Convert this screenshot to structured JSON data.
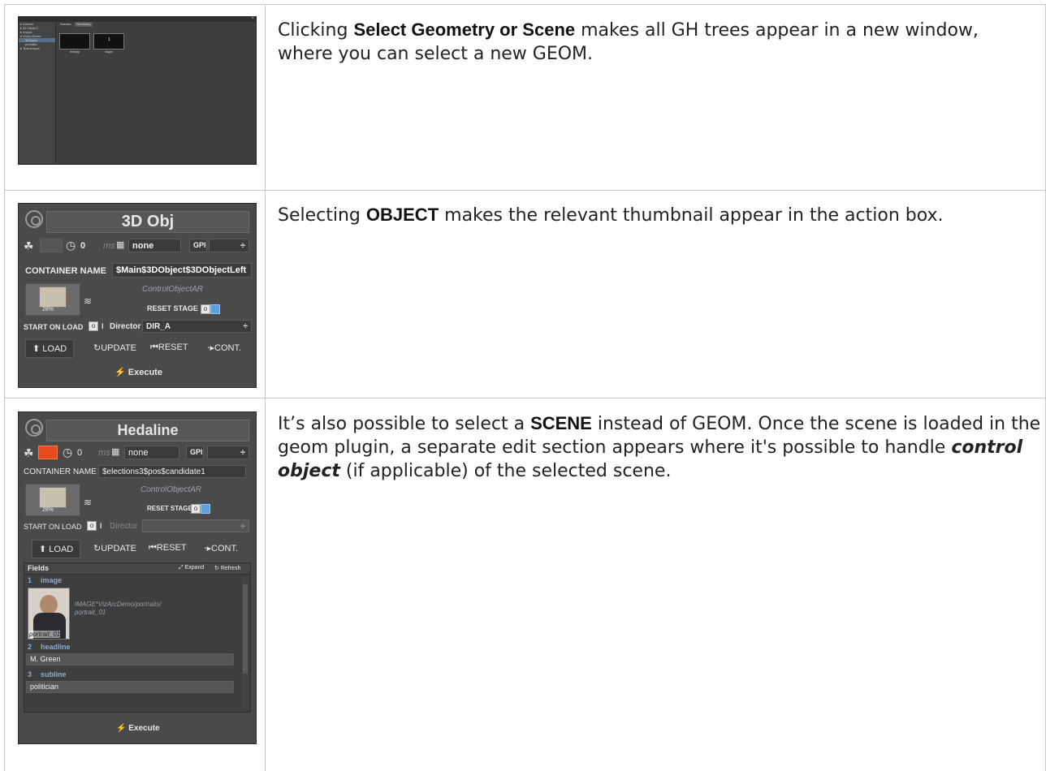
{
  "rows": [
    {
      "segments": [
        {
          "text": "Clicking ",
          "style": "normal"
        },
        {
          "text": "Select Geometry or Scene",
          "style": "bold"
        },
        {
          "text": " makes all GH trees appear in a new window, where you can select a new GEOM.",
          "style": "normal"
        }
      ]
    },
    {
      "segments": [
        {
          "text": "Selecting ",
          "style": "normal"
        },
        {
          "text": "OBJECT",
          "style": "bold"
        },
        {
          "text": " makes the relevant thumbnail appear in the action box.",
          "style": "normal"
        }
      ]
    },
    {
      "segments": [
        {
          "text": "It’s also possible to select a ",
          "style": "normal"
        },
        {
          "text": "SCENE",
          "style": "bold"
        },
        {
          "text": " instead of GEOM. Once the scene is loaded in the geom plugin, a separate edit section appears where it's possible to handle  ",
          "style": "normal"
        },
        {
          "text": "control object",
          "style": "bold-italic"
        },
        {
          "text": " (if applicable) of the selected scene.",
          "style": "normal"
        }
      ]
    }
  ],
  "browser": {
    "tree": [
      "▸ Default",
      "▸ GLOBALS",
      "▸ Import",
      "▾ VizArcDemo",
      "3Dlogos",
      "portraits",
      "▸ TeamLogos"
    ],
    "tabs": [
      "Scenes",
      "Geometry"
    ],
    "tiles": [
      {
        "caption": "embpty",
        "glyph": ""
      },
      {
        "caption": "skype",
        "glyph": "1"
      }
    ]
  },
  "panel3d": {
    "title": "3D Obj",
    "duration": "0",
    "duration_unit": "ms",
    "layout": "none",
    "gpi": "GPI",
    "container_label": "CONTAINER NAME",
    "container_value": "$Main$3DObject$3DObjectLeft",
    "control_object": "ControlObjectAR",
    "reset_stage": "RESET STAGE",
    "start_on_load": "START ON LOAD",
    "director_label": "Director",
    "director_value": "DIR_A",
    "load": "LOAD",
    "update": "UPDATE",
    "reset": "RESET",
    "cont": "CONT.",
    "execute": "Execute",
    "thumb_caption": "28%"
  },
  "panelHead": {
    "title": "Hedaline",
    "duration": "0",
    "duration_unit": "ms",
    "layout": "none",
    "gpi": "GPI",
    "container_label": "CONTAINER NAME",
    "container_value": "$elections3$pos$candidate1",
    "control_object": "ControlObjectAR",
    "reset_stage": "RESET STAGE",
    "start_on_load": "START ON LOAD",
    "director_label": "Director",
    "load": "LOAD",
    "update": "UPDATE",
    "reset": "RESET",
    "cont": "CONT.",
    "fields_label": "Fields",
    "expand": "Expand",
    "refresh": "Refresh",
    "field1_no": "1",
    "field1_name": "image",
    "image_path": "IMAGE*VizArcDemo/portraits/\nportrait_01",
    "image_caption": "portrait_01",
    "field2_no": "2",
    "field2_name": "headline",
    "field2_value": "M. Green",
    "field3_no": "3",
    "field3_name": "subline",
    "field3_value": "politician",
    "execute": "Execute",
    "thumb_caption": "28%"
  },
  "colors": {
    "accent_toggle": "#5aa0e0",
    "swatch_red": "#e8491e"
  }
}
